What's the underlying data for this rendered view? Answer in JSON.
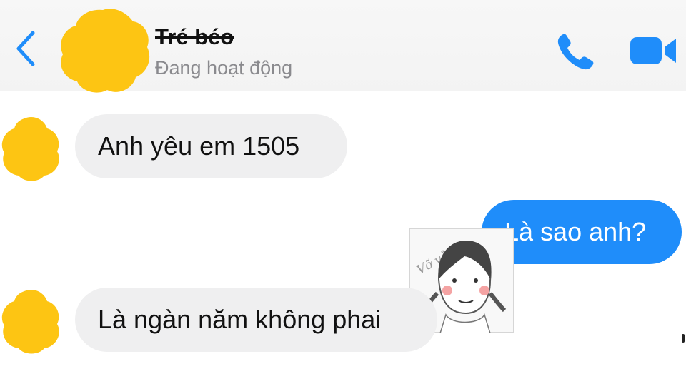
{
  "header": {
    "contact_name": "Tré béo",
    "status": "Đang hoạt động",
    "back_icon": "chevron-left-icon",
    "call_icon": "phone-icon",
    "video_icon": "video-camera-icon",
    "avatar_cover_color": "#FDC513",
    "accent_color": "#1F8DFA"
  },
  "messages": [
    {
      "direction": "in",
      "text": "Anh yêu em 1505"
    },
    {
      "direction": "out",
      "text": "Là sao anh?"
    },
    {
      "direction": "in",
      "text": "Là ngàn năm không phai"
    }
  ],
  "sticker": {
    "caption": "Vỡ vẫn !!"
  }
}
